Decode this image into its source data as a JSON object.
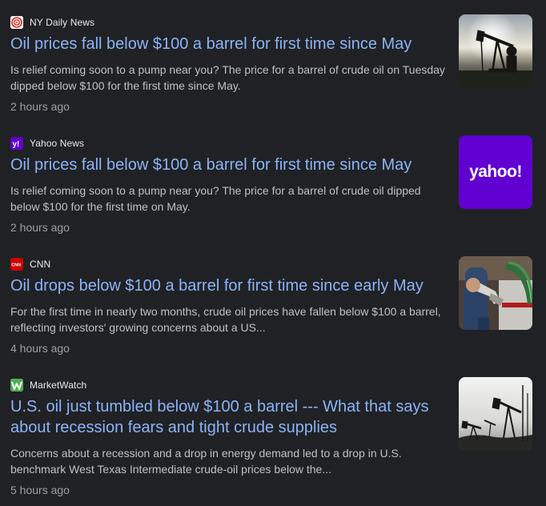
{
  "articles": [
    {
      "source": "NY Daily News",
      "source_icon": "ny-daily-news-logo",
      "headline": "Oil prices fall below $100 a barrel for first time since May",
      "snippet": "Is relief coming soon to a pump near you? The price for a barrel of crude oil on Tuesday dipped below $100 for the first time since May.",
      "time": "2 hours ago",
      "thumbnail": "oil-pump-jack-sunset-photo"
    },
    {
      "source": "Yahoo News",
      "source_icon": "yahoo-logo",
      "headline": "Oil prices fall below $100 a barrel for first time since May",
      "snippet": "Is relief coming soon to a pump near you? The price for a barrel of crude oil dipped below $100 for the first time on May.",
      "time": "2 hours ago",
      "thumbnail": "yahoo-wordmark",
      "thumbnail_text": "yahoo!"
    },
    {
      "source": "CNN",
      "source_icon": "cnn-logo",
      "headline": "Oil drops below $100 a barrel for first time since early May",
      "snippet": "For the first time in nearly two months, crude oil prices have fallen below $100 a barrel, reflecting investors' growing concerns about a US...",
      "time": "4 hours ago",
      "thumbnail": "fuel-pump-nozzle-photo"
    },
    {
      "source": "MarketWatch",
      "source_icon": "marketwatch-logo",
      "headline": "U.S. oil just tumbled below $100 a barrel --- What that says about recession fears and tight crude supplies",
      "snippet": "Concerns about a recession and a drop in energy demand led to a drop in U.S. benchmark West Texas Intermediate crude-oil prices below the...",
      "time": "5 hours ago",
      "thumbnail": "oil-pump-jacks-silhouette-photo"
    }
  ],
  "colors": {
    "background": "#202124",
    "headline": "#8ab4f8",
    "snippet": "#bdc1c6",
    "time": "#9aa0a6",
    "yahoo_purple": "#6001d2",
    "cnn_red": "#cc0000",
    "marketwatch_green": "#4caf50"
  }
}
